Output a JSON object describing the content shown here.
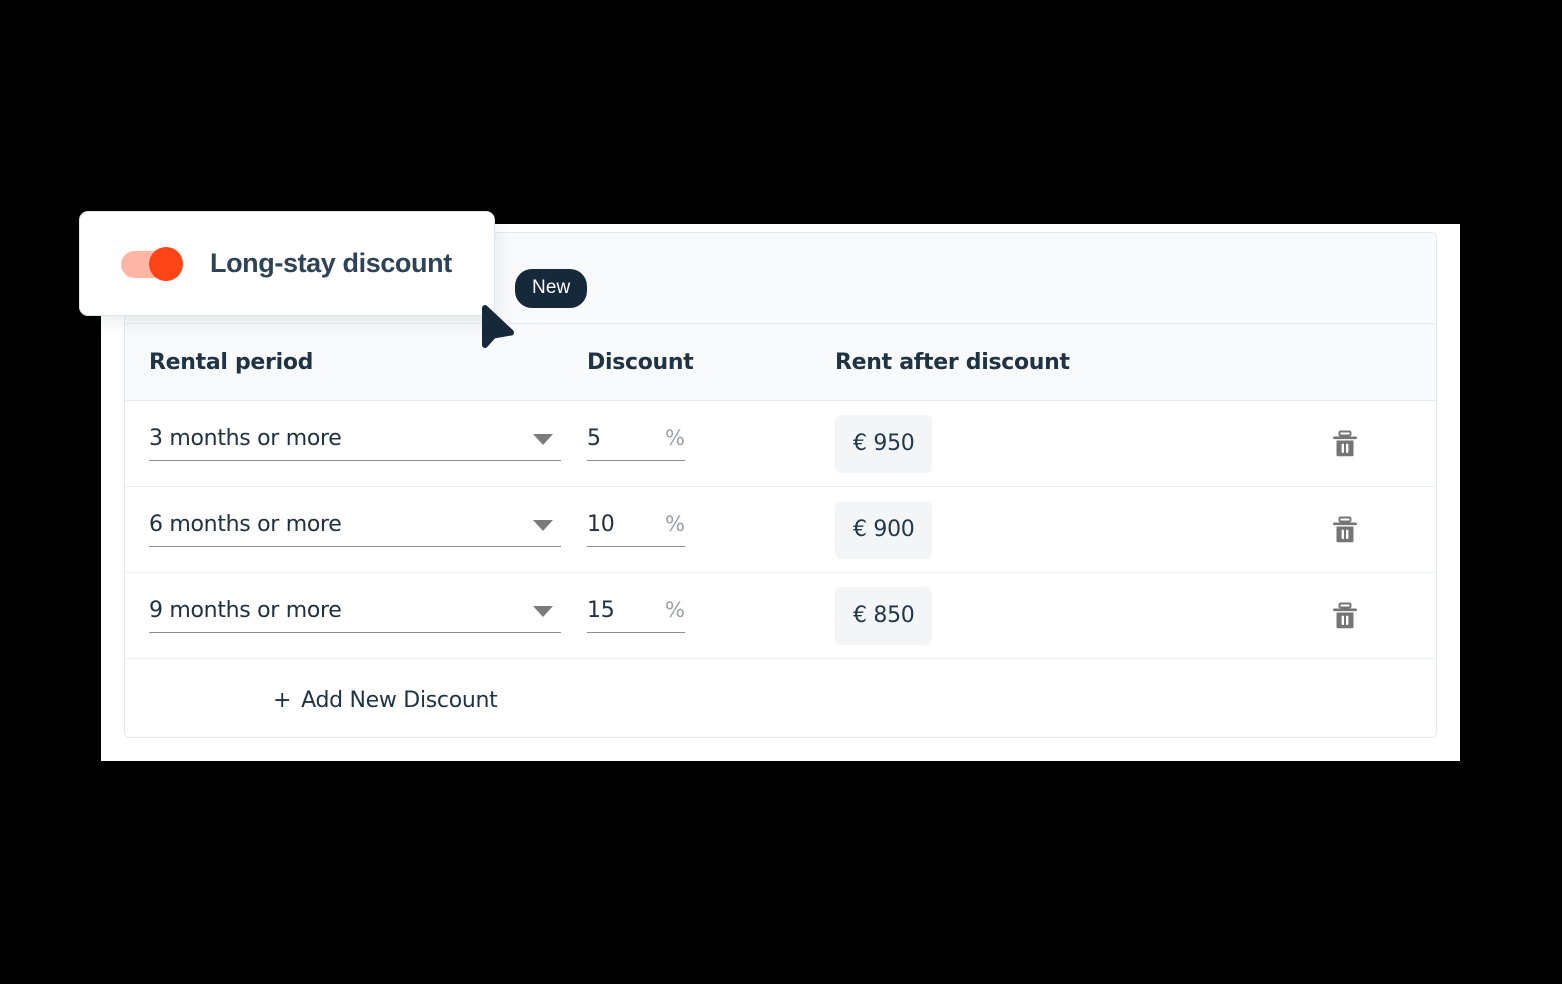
{
  "tooltip": {
    "title": "Long-stay discount",
    "toggle_on": true,
    "toggle_color": "#fc4417",
    "toggle_track_color": "#ffb6a5"
  },
  "panel": {
    "badge": "New",
    "badge_color": "#16293a"
  },
  "table": {
    "headers": {
      "period": "Rental period",
      "discount": "Discount",
      "rent": "Rent after discount",
      "action": ""
    },
    "rows": [
      {
        "period": "3 months or more",
        "discount": "5",
        "percent": "%",
        "rent": "€ 950",
        "delete_icon": "trash-icon"
      },
      {
        "period": "6 months or more",
        "discount": "10",
        "percent": "%",
        "rent": "€ 900",
        "delete_icon": "trash-icon"
      },
      {
        "period": "9 months or more",
        "discount": "15",
        "percent": "%",
        "rent": "€ 850",
        "delete_icon": "trash-icon"
      }
    ],
    "add_row": {
      "plus": "+",
      "label": "Add New Discount"
    }
  },
  "colors": {
    "accent": "#fc4417",
    "text_dark": "#1f3344",
    "header_bg": "#f8f9fa",
    "chip_bg": "#f4f5f7",
    "border": "#e7ebf0"
  }
}
